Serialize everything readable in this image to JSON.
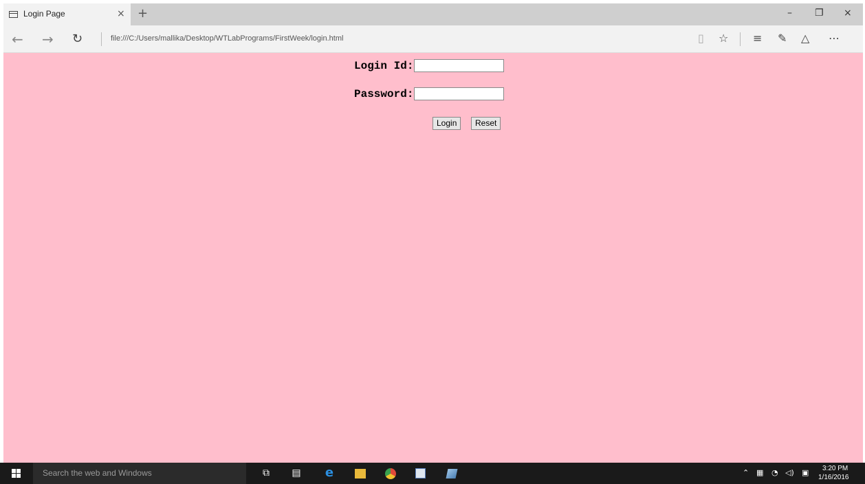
{
  "browser": {
    "tab_title": "Login Page",
    "address": "file:///C:/Users/mallika/Desktop/WTLabPrograms/FirstWeek/login.html",
    "icons": [
      "tab-page-icon",
      "close-tab-icon",
      "new-tab-icon",
      "back-arrow-icon",
      "forward-arrow-icon",
      "refresh-icon",
      "reading-view-icon",
      "favorite-star-icon",
      "hub-icon",
      "web-note-icon",
      "share-icon",
      "more-icon",
      "minimize-icon",
      "restore-icon",
      "close-window-icon"
    ]
  },
  "page": {
    "background": "#ffbecc",
    "login_label": "Login Id:",
    "password_label": "Password:",
    "login_value": "",
    "password_value": "",
    "login_button": "Login",
    "reset_button": "Reset"
  },
  "taskbar": {
    "search_placeholder": "Search the web and Windows",
    "time": "3:20 PM",
    "date": "1/16/2016",
    "icons": [
      "windows-start-icon",
      "task-view-icon",
      "store-icon",
      "edge-icon",
      "file-explorer-icon",
      "chrome-icon",
      "word-icon",
      "app-icon",
      "show-hidden-icon",
      "network-icon",
      "wifi-icon",
      "volume-icon",
      "notifications-icon"
    ]
  }
}
